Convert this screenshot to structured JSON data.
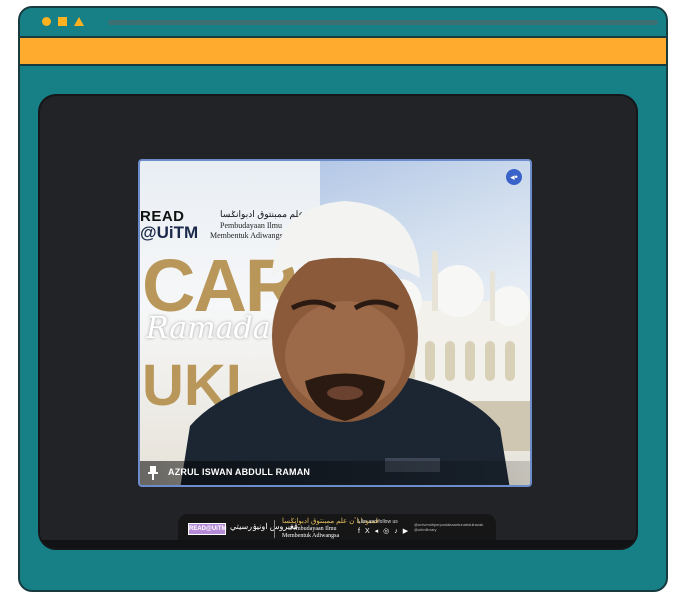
{
  "colors": {
    "frame_teal": "#177f86",
    "toolbar_orange": "#ffac2e",
    "window_dots": "#ffb11f",
    "video_border": "#6d8ccc",
    "banner_gold": "#b9975a",
    "content_dark": "#222326"
  },
  "window": {
    "controls": [
      "circle",
      "square",
      "triangle"
    ]
  },
  "video": {
    "participant_name": "AZRUL ISWAN ABDULL RAMAN",
    "audio_icon": "audio-indicator-icon",
    "pin_icon": "pin-icon",
    "background": {
      "read_text": "READ",
      "uitm_text": "@UiTM",
      "arabic_line": "ڤمبوداياٴن علم ممبنتوق ادبوانݢسا",
      "sub_line1": "Pembudayaan Ilmu",
      "sub_line2": "Membentuk Adiwangsa",
      "big_text1": "CAR",
      "big_text2": "UKI",
      "script_text": "Ramadan"
    }
  },
  "footer": {
    "logo_text": "READ@UiTM",
    "arabic_left": "ڤڠيروس اونيۏرسيتي",
    "arabic_right": "ڤمبوداياٴن علم ممبنتوق ادبوانݢسا",
    "sub_line1": "Pembudayaan Ilmu",
    "sub_line2": "Membentuk Adiwangsa",
    "like_text": "Like and follow us",
    "social_icons": [
      "facebook-icon",
      "x-icon",
      "telegram-icon",
      "instagram-icon",
      "tiktok-icon",
      "youtube-icon"
    ],
    "social_glyphs": [
      "f",
      "X",
      "◂",
      "◎",
      "♪",
      "▶"
    ],
    "handles": "@universitiperpustakaantunabdulrazak @uitmlibrary"
  }
}
